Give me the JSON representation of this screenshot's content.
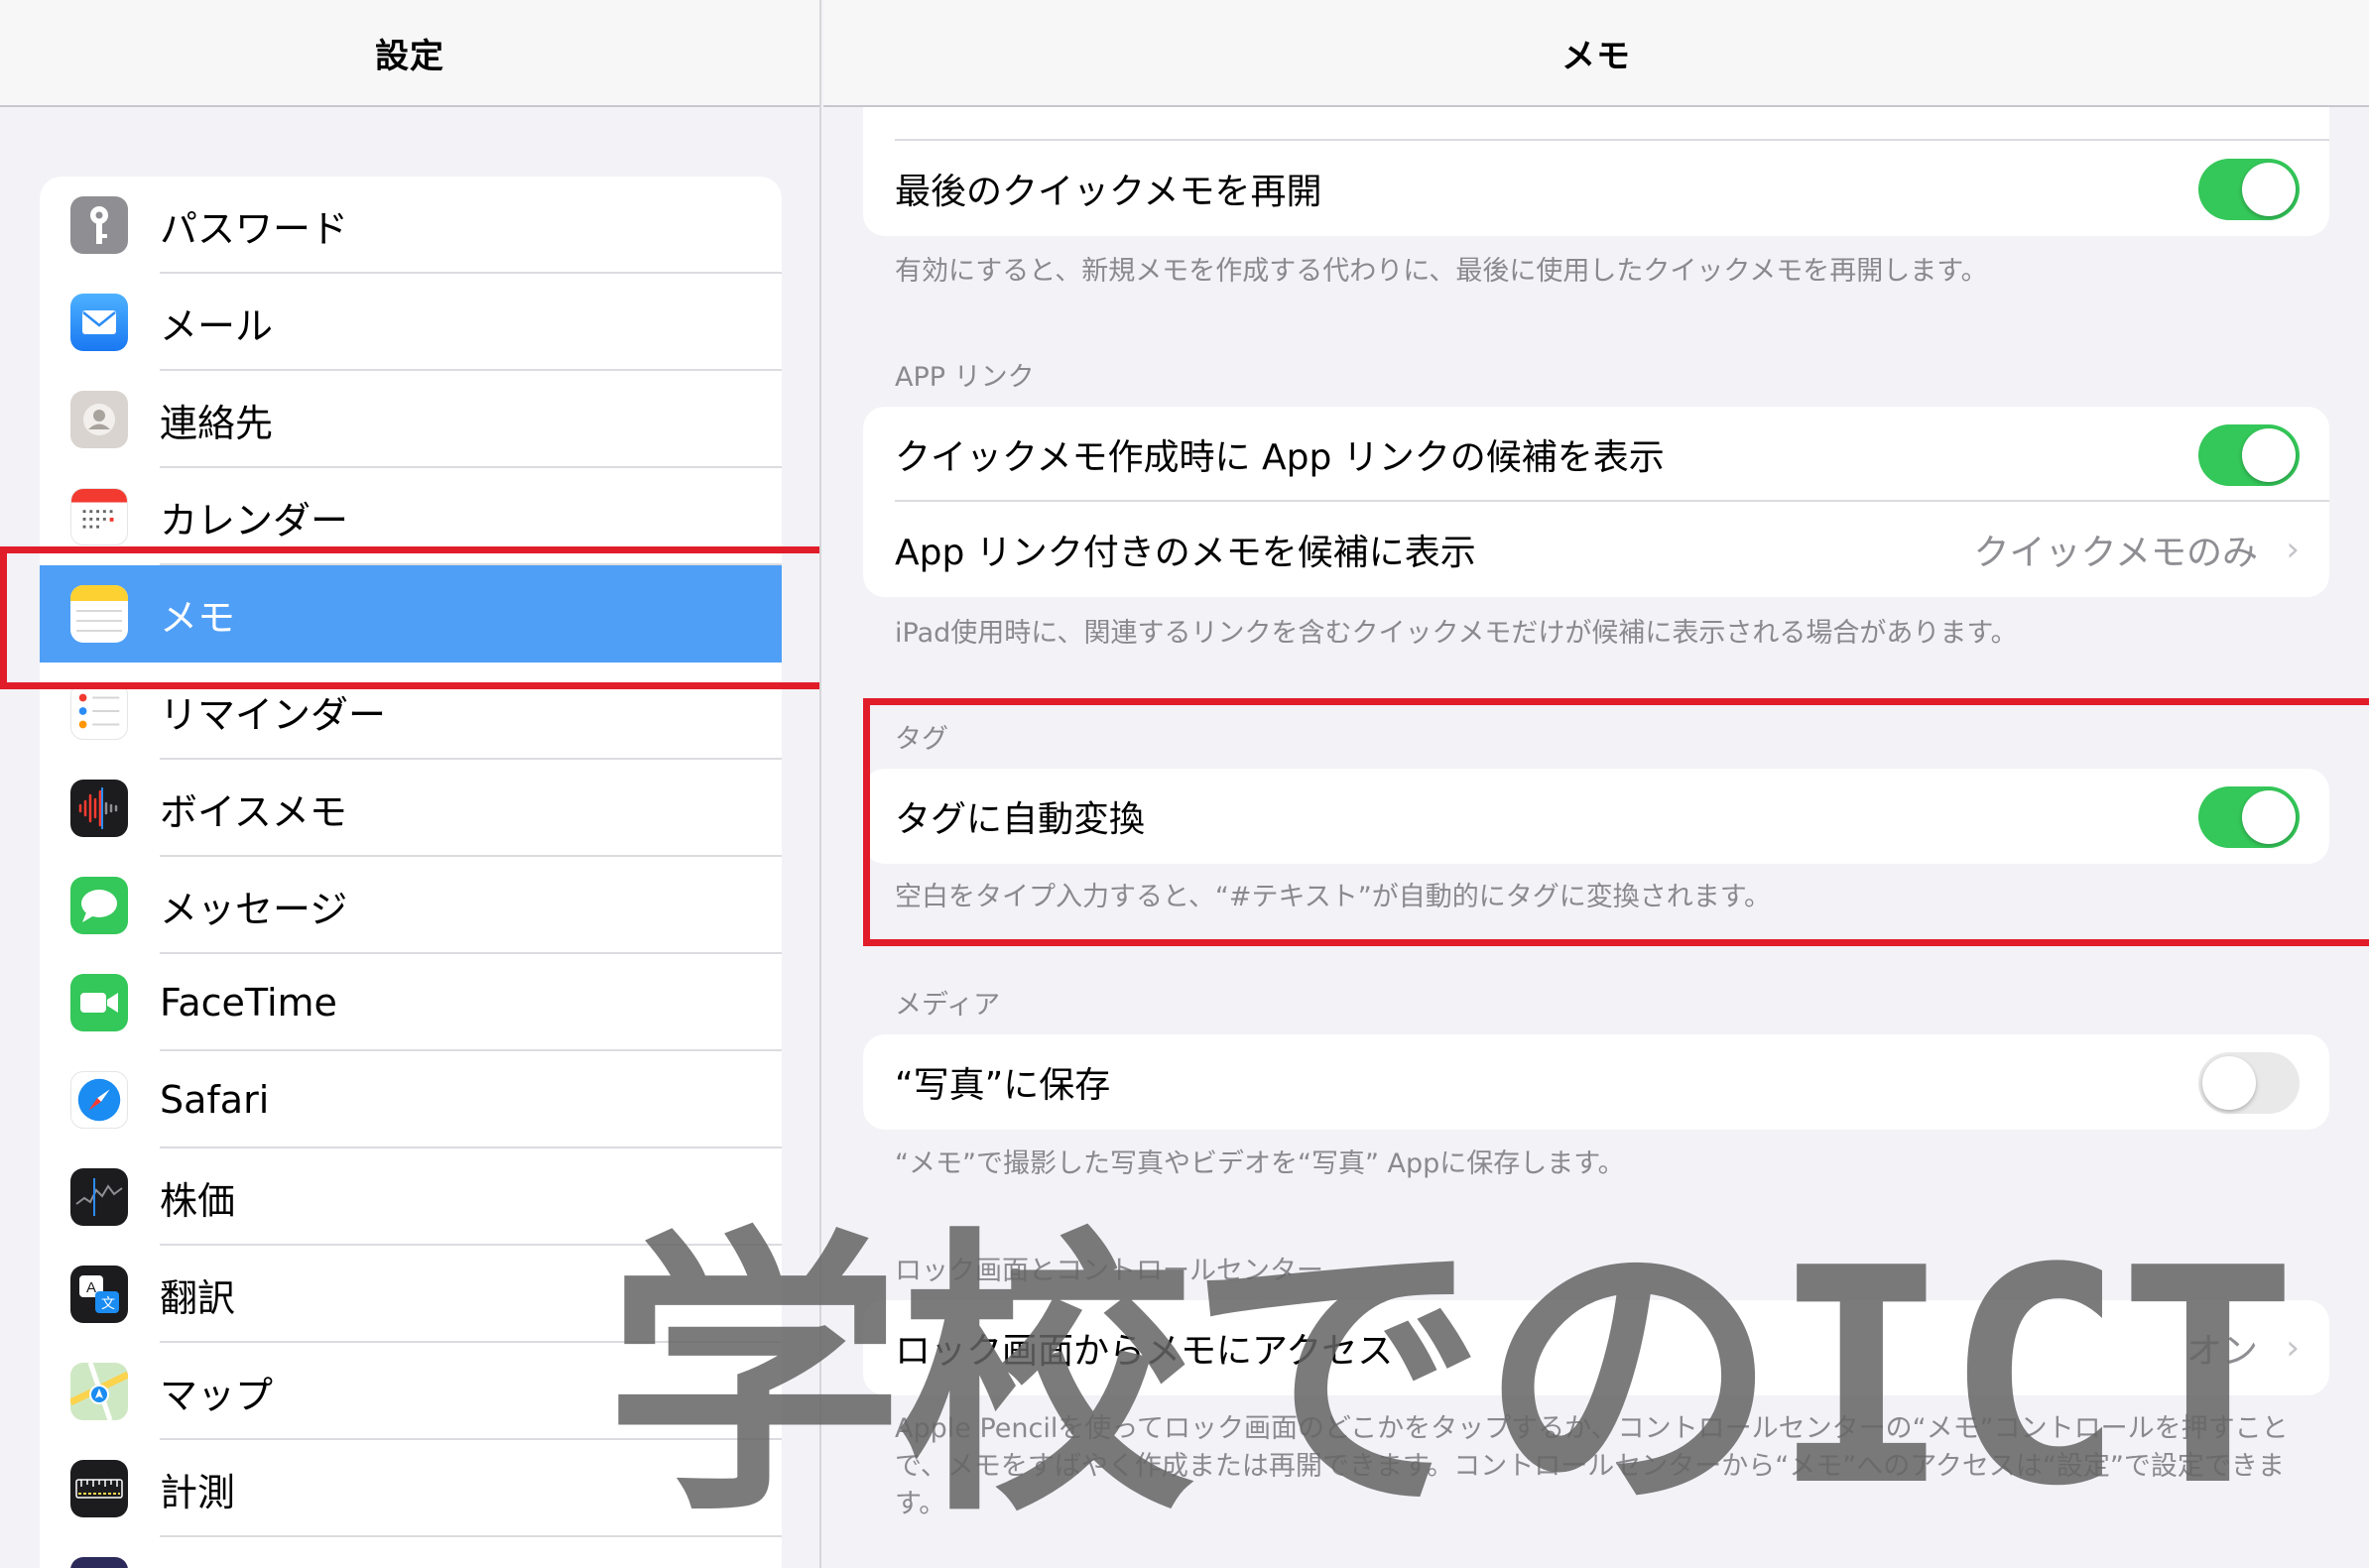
{
  "left_pane": {
    "title": "設定",
    "items": [
      {
        "label": "パスワード",
        "icon": "key-icon"
      },
      {
        "label": "メール",
        "icon": "mail-icon"
      },
      {
        "label": "連絡先",
        "icon": "contacts-icon"
      },
      {
        "label": "カレンダー",
        "icon": "calendar-icon"
      },
      {
        "label": "メモ",
        "icon": "notes-icon",
        "selected": true
      },
      {
        "label": "リマインダー",
        "icon": "reminders-icon"
      },
      {
        "label": "ボイスメモ",
        "icon": "voice-memos-icon"
      },
      {
        "label": "メッセージ",
        "icon": "messages-icon"
      },
      {
        "label": "FaceTime",
        "icon": "facetime-icon"
      },
      {
        "label": "Safari",
        "icon": "safari-icon"
      },
      {
        "label": "株価",
        "icon": "stocks-icon"
      },
      {
        "label": "翻訳",
        "icon": "translate-icon"
      },
      {
        "label": "マップ",
        "icon": "maps-icon"
      },
      {
        "label": "計測",
        "icon": "measure-icon"
      }
    ]
  },
  "right_pane": {
    "title": "メモ",
    "quick_note": {
      "resume_label": "最後のクイックメモを再開",
      "resume_on": true,
      "footer": "有効にすると、新規メモを作成する代わりに、最後に使用したクイックメモを再開します。"
    },
    "app_links": {
      "header": "APP リンク",
      "suggest_label": "クイックメモ作成時に App リンクの候補を表示",
      "suggest_on": true,
      "show_label": "App リンク付きのメモを候補に表示",
      "show_value": "クイックメモのみ",
      "footer": "iPad使用時に、関連するリンクを含むクイックメモだけが候補に表示される場合があります。"
    },
    "tags": {
      "header": "タグ",
      "auto_label": "タグに自動変換",
      "auto_on": true,
      "footer": "空白をタイプ入力すると、“#テキスト”が自動的にタグに変換されます。"
    },
    "media": {
      "header": "メディア",
      "save_label": "“写真”に保存",
      "save_on": false,
      "footer": "“メモ”で撮影した写真やビデオを“写真” Appに保存します。"
    },
    "lock_screen": {
      "header": "ロック画面とコントロールセンター",
      "access_label": "ロック画面からメモにアクセス",
      "access_value": "オン",
      "footer": "Apple Pencilを使ってロック画面のどこかをタップするか、コントロールセンターの“メモ”コントロールを押すことで、メモをすばやく作成または再開できます。コントロールセンターから“メモ”へのアクセスは“設定”で設定できます。"
    }
  },
  "watermark": "学校でのICT",
  "colors": {
    "selected_row": "#4f9ff7",
    "toggle_on": "#34c759",
    "highlight": "#e11d2a"
  }
}
